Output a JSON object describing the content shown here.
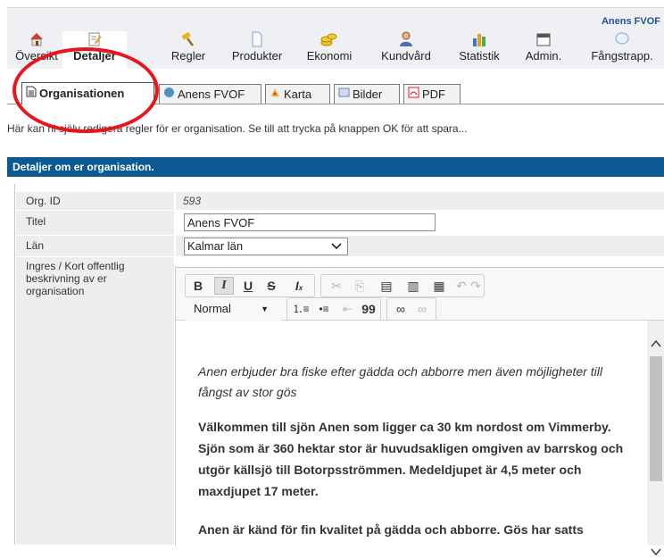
{
  "header": {
    "org_name": "Anens FVOF"
  },
  "nav": [
    {
      "label": "Översikt",
      "icon": "home-icon"
    },
    {
      "label": "Detaljer",
      "icon": "edit-document-icon",
      "active": true
    },
    {
      "label": "Regler",
      "icon": "hammer-icon"
    },
    {
      "label": "Produkter",
      "icon": "document-icon"
    },
    {
      "label": "Ekonomi",
      "icon": "coins-icon"
    },
    {
      "label": "Kundvård",
      "icon": "user-icon"
    },
    {
      "label": "Statistik",
      "icon": "bar-chart-icon"
    },
    {
      "label": "Admin.",
      "icon": "calendar-icon"
    },
    {
      "label": "Fångstrapp.",
      "icon": "chat-bubble-icon"
    }
  ],
  "subtabs": [
    {
      "label": "Organisationen",
      "icon": "page-icon",
      "active": true
    },
    {
      "label": "Anens FVOF",
      "icon": "globe-icon"
    },
    {
      "label": "Karta",
      "icon": "map-icon"
    },
    {
      "label": "Bilder",
      "icon": "image-icon"
    },
    {
      "label": "PDF",
      "icon": "pdf-icon"
    }
  ],
  "help_text": "Här kan ni själv redigera regler för er organisation. Se till att trycka på knappen OK för att spara...",
  "section_title": "Detaljer om er organisation.",
  "form": {
    "org_id": {
      "label": "Org. ID",
      "value": "593"
    },
    "title": {
      "label": "Titel",
      "value": "Anens FVOF"
    },
    "county": {
      "label": "Län",
      "value": "Kalmar län"
    },
    "description": {
      "label": "Ingres / Kort offentlig beskrivning av er organisation"
    }
  },
  "editor": {
    "format_value": "Normal",
    "lead": "Anen erbjuder bra fiske efter gädda och abborre men även möjligheter till fångst av stor gös",
    "paragraph1": "Välkommen till sjön Anen som ligger ca 30 km nordost om Vimmerby. Sjön som är 360 hektar stor är huvudsakligen omgiven av barrskog och utgör källsjö till Botorpsströmmen. Medeldjupet är 4,5 meter och maxdjupet 17 meter.",
    "paragraph2": "Anen är känd för fin kvalitet på gädda och abborre. Gös har satts"
  },
  "colors": {
    "section_header": "#0d5a92",
    "org_name": "#1f4f9e",
    "annotation_circle": "#e8151b"
  }
}
